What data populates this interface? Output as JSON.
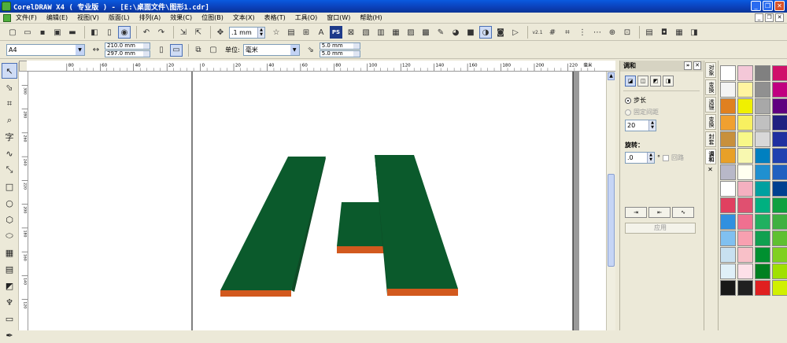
{
  "window": {
    "title": "CorelDRAW X4 ( 专业版 ) - [E:\\桌面文件\\图形1.cdr]",
    "buttons": [
      "_",
      "❐",
      "✕"
    ]
  },
  "menu": {
    "items": [
      "文件(F)",
      "编辑(E)",
      "视图(V)",
      "版面(L)",
      "排列(A)",
      "效果(C)",
      "位图(B)",
      "文本(X)",
      "表格(T)",
      "工具(O)",
      "窗口(W)",
      "帮助(H)"
    ],
    "mdi_buttons": [
      "_",
      "❐",
      "✕"
    ]
  },
  "toolbar": {
    "nudge_value": ".1 mm",
    "ps_label": "PS",
    "version_label": "v2.1"
  },
  "propbar": {
    "page_size": "A4",
    "width": "210.0 mm",
    "height": "297.0 mm",
    "units_label": "单位:",
    "units_value": "毫米",
    "dup_x": "5.0 mm",
    "dup_y": "5.0 mm"
  },
  "ruler": {
    "h_labels": [
      "80",
      "60",
      "40",
      "20",
      "0",
      "20",
      "40",
      "60",
      "80",
      "100",
      "120",
      "140",
      "160",
      "180",
      "200",
      "220"
    ],
    "h_unit": "毫米",
    "v_labels": [
      "300",
      "280",
      "260",
      "240",
      "220",
      "200",
      "180",
      "160",
      "140",
      "120"
    ]
  },
  "docker": {
    "title": "调和",
    "steps_label": "步长",
    "fixed_spacing_label": "固定间距",
    "steps_value": "20",
    "rotation_label": "旋转：",
    "rotation_value": ".0",
    "degree_symbol": "°",
    "loop_label": "回路",
    "apply_label": "应用",
    "collapse_btn": "»",
    "close_btn": "✕"
  },
  "docker_tabs": [
    "对象",
    "变换",
    "透镜",
    "变换",
    "封套",
    "调和"
  ],
  "colors": {
    "shape_face": "#0b5a2c",
    "shape_side": "#0f4a26",
    "shape_edge": "#d2591e",
    "shape_edge_light": "#c86a30"
  },
  "palette": {
    "columns": [
      [
        "#ffffff",
        "#f4f4f4",
        "#e08020",
        "#f0a030",
        "#c8903c",
        "#e8a028",
        "#b8b8c8",
        "#ffffff",
        "#e04060",
        "#3090e0",
        "#80c0f0",
        "#c8e0f0",
        "#e0f0f8",
        "#181818"
      ],
      [
        "#f4c8d8",
        "#fff4a0",
        "#f0f000",
        "#f8f060",
        "#f8f888",
        "#f8f8b0",
        "#fffff0",
        "#f4b0c0",
        "#e05070",
        "#f07090",
        "#f8a0b0",
        "#f8c0c8",
        "#fde0e8",
        "#202020"
      ],
      [
        "#808080",
        "#909090",
        "#a8a8a8",
        "#c0c0c0",
        "#d8d8d8",
        "#0080c0",
        "#2090d0",
        "#00a0a0",
        "#00b080",
        "#20b060",
        "#10a050",
        "#009030",
        "#008020",
        "#e02020"
      ],
      [
        "#d0106a",
        "#c00080",
        "#600080",
        "#202080",
        "#2030a0",
        "#2040b0",
        "#2060c0",
        "#004090",
        "#10a040",
        "#40b040",
        "#60c030",
        "#80d020",
        "#a0e000",
        "#d0f000"
      ]
    ]
  }
}
